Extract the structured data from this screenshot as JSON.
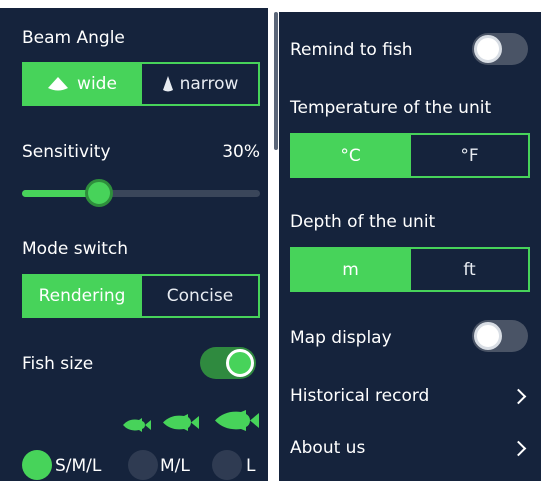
{
  "left": {
    "beam_angle": {
      "title": "Beam Angle",
      "options": [
        "wide",
        "narrow"
      ],
      "selected": "wide"
    },
    "sensitivity": {
      "title": "Sensitivity",
      "value_label": "30%",
      "value": 0.3
    },
    "mode_switch": {
      "title": "Mode switch",
      "options": [
        "Rendering",
        "Concise"
      ],
      "selected": "Rendering"
    },
    "fish_size": {
      "title": "Fish size",
      "enabled": true,
      "sizes": [
        {
          "label": "S/M/L",
          "selected": true
        },
        {
          "label": "M/L",
          "selected": false
        },
        {
          "label": "L",
          "selected": false
        }
      ]
    }
  },
  "right": {
    "remind": {
      "title": "Remind to fish",
      "enabled": false
    },
    "temperature": {
      "title": "Temperature of the unit",
      "options": [
        "°C",
        "°F"
      ],
      "selected": "°C"
    },
    "depth": {
      "title": "Depth of the unit",
      "options": [
        "m",
        "ft"
      ],
      "selected": "m"
    },
    "map": {
      "title": "Map display",
      "enabled": false
    },
    "history": {
      "title": "Historical record"
    },
    "about": {
      "title": "About us"
    }
  },
  "colors": {
    "accent": "#47d35a",
    "background": "#15233c",
    "track": "#3a465a",
    "toggle_off": "#4a5466"
  },
  "icons": {
    "wide": "wide-beam-icon",
    "narrow": "narrow-beam-icon",
    "fish": "fish-icon",
    "chevron": "chevron-right-icon"
  }
}
